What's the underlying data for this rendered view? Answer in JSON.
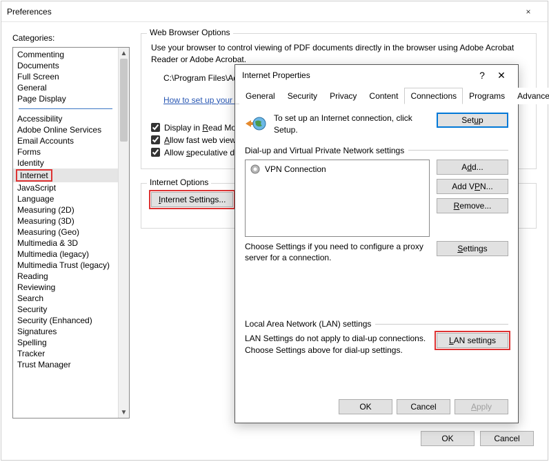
{
  "prefs": {
    "title": "Preferences",
    "close_label": "×",
    "categories_label": "Categories:",
    "categories_group1": [
      "Commenting",
      "Documents",
      "Full Screen",
      "General",
      "Page Display"
    ],
    "categories_group2": [
      "Accessibility",
      "Adobe Online Services",
      "Email Accounts",
      "Forms",
      "Identity",
      "Internet",
      "JavaScript",
      "Language",
      "Measuring (2D)",
      "Measuring (3D)",
      "Measuring (Geo)",
      "Multimedia & 3D",
      "Multimedia (legacy)",
      "Multimedia Trust (legacy)",
      "Reading",
      "Reviewing",
      "Search",
      "Security",
      "Security (Enhanced)",
      "Signatures",
      "Spelling",
      "Tracker",
      "Trust Manager"
    ],
    "selected_category": "Internet",
    "ok_label": "OK",
    "cancel_label": "Cancel"
  },
  "web": {
    "group_label": "Web Browser Options",
    "desc1": "Use your browser to control viewing of PDF documents directly in the browser using Adobe Acrobat",
    "desc2": "Reader or Adobe Acrobat.",
    "path": "C:\\Program Files\\Adob",
    "link": "How to set up your brow",
    "cb1_prefix": "Display in ",
    "cb1_u": "R",
    "cb1_suffix": "ead Mode",
    "cb2_prefix": "",
    "cb2_u": "A",
    "cb2_suffix": "llow fast web view",
    "cb3_prefix": "Allow ",
    "cb3_u": "s",
    "cb3_suffix": "peculative dow"
  },
  "internet_opts": {
    "group_label": "Internet Options",
    "btn_u": "I",
    "btn_suffix": "nternet Settings..."
  },
  "ip": {
    "title": "Internet Properties",
    "help_label": "?",
    "close_label": "✕",
    "tabs": [
      "General",
      "Security",
      "Privacy",
      "Content",
      "Connections",
      "Programs",
      "Advanced"
    ],
    "active_tab": "Connections",
    "setup_text": "To set up an Internet connection, click Setup.",
    "setup_btn_u": "u",
    "setup_btn_prefix": "Set",
    "setup_btn_suffix": "p",
    "dialup_group": "Dial-up and Virtual Private Network settings",
    "vpn_item": "VPN Connection",
    "add_btn_prefix": "A",
    "add_btn_u": "d",
    "add_btn_suffix": "d...",
    "addvpn_prefix": "Add V",
    "addvpn_u": "P",
    "addvpn_suffix": "N...",
    "remove_u": "R",
    "remove_suffix": "emove...",
    "settings_u": "S",
    "settings_suffix": "ettings",
    "proxy_text": "Choose Settings if you need to configure a proxy server for a connection.",
    "lan_group": "Local Area Network (LAN) settings",
    "lan_text": "LAN Settings do not apply to dial-up connections. Choose Settings above for dial-up settings.",
    "lan_btn_u": "L",
    "lan_btn_suffix": "AN settings",
    "ok_label": "OK",
    "cancel_label": "Cancel",
    "apply_u": "A",
    "apply_suffix": "pply"
  }
}
